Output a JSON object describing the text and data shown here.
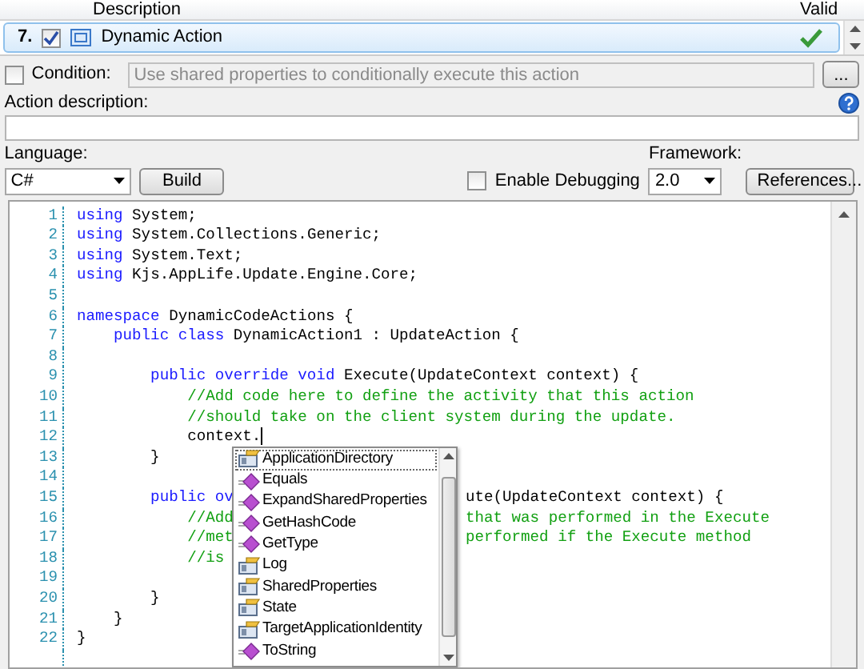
{
  "action_list": {
    "columns": [
      {
        "label": "Description",
        "kind": "description"
      },
      {
        "label": "Valid",
        "kind": "valid"
      }
    ],
    "rows": [
      {
        "number": "7.",
        "enabled": true,
        "name": "Dynamic Action",
        "valid": true,
        "selected": true
      }
    ]
  },
  "condition": {
    "label": "Condition:",
    "checked": false,
    "placeholder": "Use shared properties to conditionally execute this action",
    "browse_button": "..."
  },
  "action_description": {
    "label": "Action description:"
  },
  "language": {
    "label": "Language:",
    "value": "C#"
  },
  "build_button": "Build",
  "enable_debugging": {
    "label": "Enable Debugging",
    "checked": false
  },
  "framework": {
    "label": "Framework:",
    "value": "2.0"
  },
  "references_button": "References...",
  "editor": {
    "lines": [
      {
        "number": "1",
        "tokens": [
          {
            "kind": "keyword",
            "text": "using"
          },
          {
            "kind": "plain",
            "text": " System;"
          }
        ]
      },
      {
        "number": "2",
        "tokens": [
          {
            "kind": "keyword",
            "text": "using"
          },
          {
            "kind": "plain",
            "text": " System.Collections.Generic;"
          }
        ]
      },
      {
        "number": "3",
        "tokens": [
          {
            "kind": "keyword",
            "text": "using"
          },
          {
            "kind": "plain",
            "text": " System.Text;"
          }
        ]
      },
      {
        "number": "4",
        "tokens": [
          {
            "kind": "keyword",
            "text": "using"
          },
          {
            "kind": "plain",
            "text": " Kjs.AppLife.Update.Engine.Core;"
          }
        ]
      },
      {
        "number": "5"
      },
      {
        "number": "6",
        "tokens": [
          {
            "kind": "keyword",
            "text": "namespace"
          },
          {
            "kind": "plain",
            "text": " DynamicCodeActions {"
          }
        ]
      },
      {
        "number": "7",
        "tokens": [
          {
            "kind": "keyword",
            "text": "    public class"
          },
          {
            "kind": "plain",
            "text": " DynamicAction1 : UpdateAction {"
          }
        ]
      },
      {
        "number": "8"
      },
      {
        "number": "9",
        "tokens": [
          {
            "kind": "keyword",
            "text": "        public override void"
          },
          {
            "kind": "plain",
            "text": " Execute(UpdateContext context) {"
          }
        ]
      },
      {
        "number": "10",
        "tokens": [
          {
            "kind": "comment",
            "text": "            //Add code here to define the activity that this action"
          }
        ]
      },
      {
        "number": "11",
        "tokens": [
          {
            "kind": "comment",
            "text": "            //should take on the client system during the update."
          }
        ]
      },
      {
        "number": "12",
        "tokens": [
          {
            "kind": "plain",
            "text": "            context."
          }
        ],
        "caret": true
      },
      {
        "number": "13",
        "tokens": [
          {
            "kind": "plain",
            "text": "        }"
          }
        ]
      },
      {
        "number": "14"
      },
      {
        "number": "15",
        "tokens": [
          {
            "kind": "keyword",
            "text": "        public ov"
          }
        ],
        "right_tokens": [
          {
            "kind": "plain",
            "text": "ute(UpdateContext context) {"
          }
        ]
      },
      {
        "number": "16",
        "tokens": [
          {
            "kind": "comment",
            "text": "            //Add"
          }
        ],
        "right_tokens": [
          {
            "kind": "comment",
            "text": "that was performed in the Execute"
          }
        ]
      },
      {
        "number": "17",
        "tokens": [
          {
            "kind": "comment",
            "text": "            //met"
          }
        ],
        "right_tokens": [
          {
            "kind": "comment",
            "text": "performed if the Execute method"
          }
        ]
      },
      {
        "number": "18",
        "tokens": [
          {
            "kind": "comment",
            "text": "            //is"
          }
        ]
      },
      {
        "number": "19"
      },
      {
        "number": "20",
        "tokens": [
          {
            "kind": "plain",
            "text": "        }"
          }
        ]
      },
      {
        "number": "21",
        "tokens": [
          {
            "kind": "plain",
            "text": "    }"
          }
        ]
      },
      {
        "number": "22",
        "tokens": [
          {
            "kind": "plain",
            "text": "}"
          }
        ]
      }
    ]
  },
  "completion_list": {
    "items": [
      {
        "label": "ApplicationDirectory",
        "kind": "property",
        "selected": true
      },
      {
        "label": "Equals",
        "kind": "method",
        "selected": false
      },
      {
        "label": "ExpandSharedProperties",
        "kind": "method",
        "selected": false
      },
      {
        "label": "GetHashCode",
        "kind": "method",
        "selected": false
      },
      {
        "label": "GetType",
        "kind": "method",
        "selected": false
      },
      {
        "label": "Log",
        "kind": "property",
        "selected": false
      },
      {
        "label": "SharedProperties",
        "kind": "property",
        "selected": false
      },
      {
        "label": "State",
        "kind": "property",
        "selected": false
      },
      {
        "label": "TargetApplicationIdentity",
        "kind": "property",
        "selected": false
      },
      {
        "label": "ToString",
        "kind": "method",
        "selected": false
      }
    ]
  }
}
